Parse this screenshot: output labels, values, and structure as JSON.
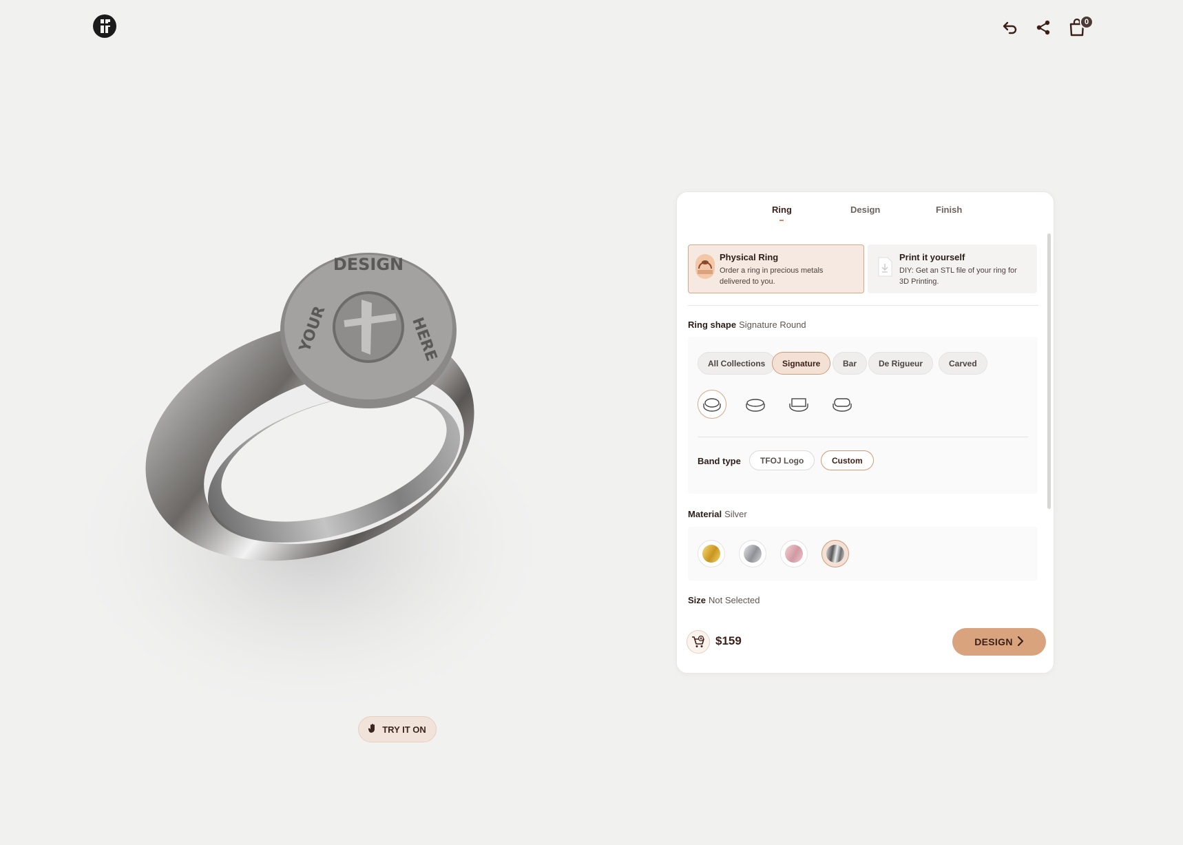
{
  "header": {
    "logo": "tf-logo",
    "cart_count": "0",
    "icons": [
      "undo-icon",
      "share-icon",
      "cart-icon"
    ]
  },
  "try_on": {
    "label": "TRY IT ON"
  },
  "tabs": [
    {
      "label": "Ring",
      "active": true
    },
    {
      "label": "Design",
      "active": false
    },
    {
      "label": "Finish",
      "active": false
    }
  ],
  "product_types": [
    {
      "title": "Physical Ring",
      "desc": "Order a ring in precious metals delivered to you.",
      "selected": true
    },
    {
      "title": "Print it yourself",
      "desc": "DIY: Get an STL file of your ring for 3D Printing.",
      "selected": false
    }
  ],
  "ring_shape": {
    "label": "Ring shape",
    "value": "Signature Round",
    "collections": [
      {
        "label": "All Collections",
        "selected": false
      },
      {
        "label": "Signature",
        "selected": true
      },
      {
        "label": "Bar",
        "selected": false
      },
      {
        "label": "De Rigueur",
        "selected": false
      },
      {
        "label": "Carved",
        "selected": false
      }
    ],
    "shapes": [
      "round-shape-icon",
      "oval-shape-icon",
      "square-shape-icon",
      "cushion-shape-icon"
    ],
    "selected_shape": "round-shape-icon"
  },
  "band_type": {
    "label": "Band type",
    "options": [
      {
        "label": "TFOJ Logo",
        "selected": false
      },
      {
        "label": "Custom",
        "selected": true
      }
    ]
  },
  "material": {
    "label": "Material",
    "value": "Silver",
    "swatches": [
      {
        "name": "gold",
        "color": "#d9b23a"
      },
      {
        "name": "white-gold",
        "color": "#b9bcc1"
      },
      {
        "name": "rose-gold",
        "color": "#e3b7bd"
      },
      {
        "name": "silver",
        "color": "#8f8f8f",
        "selected": true
      }
    ]
  },
  "size": {
    "label": "Size",
    "value": "Not Selected"
  },
  "footer": {
    "price": "$159",
    "cta": "DESIGN"
  },
  "colors": {
    "accent": "#d9a47d",
    "accent_light": "#f3e1d5",
    "text_dark": "#3a1f17"
  }
}
